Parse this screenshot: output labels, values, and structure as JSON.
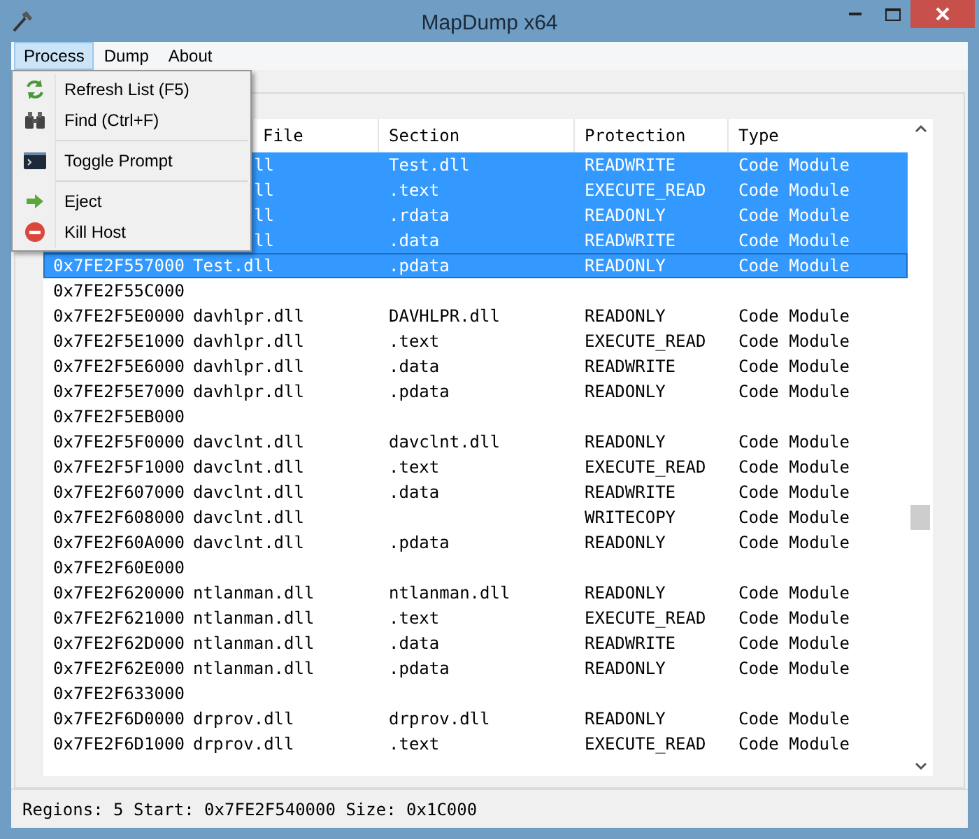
{
  "window": {
    "title": "MapDump x64"
  },
  "menubar": [
    {
      "label": "Process",
      "selected": true
    },
    {
      "label": "Dump",
      "selected": false
    },
    {
      "label": "About",
      "selected": false
    }
  ],
  "open_menu": [
    {
      "kind": "item",
      "label": "Refresh List (F5)"
    },
    {
      "kind": "item",
      "label": "Find (Ctrl+F)"
    },
    {
      "kind": "separator"
    },
    {
      "kind": "item",
      "label": "Toggle Prompt"
    },
    {
      "kind": "separator"
    },
    {
      "kind": "item",
      "label": "Eject"
    },
    {
      "kind": "item",
      "label": "Kill Host"
    }
  ],
  "table": {
    "columns": [
      "File",
      "Section",
      "Protection",
      "Type"
    ],
    "rows": [
      {
        "covered": true,
        "selected": true,
        "file": "ll",
        "section": "Test.dll",
        "protection": "READWRITE",
        "type": "Code Module"
      },
      {
        "covered": true,
        "selected": true,
        "file": "ll",
        "section": ".text",
        "protection": "EXECUTE_READ",
        "type": "Code Module"
      },
      {
        "covered": true,
        "selected": true,
        "file": "ll",
        "section": ".rdata",
        "protection": "READONLY",
        "type": "Code Module"
      },
      {
        "covered": true,
        "selected": true,
        "file": "ll",
        "section": ".data",
        "protection": "READWRITE",
        "type": "Code Module"
      },
      {
        "covered": false,
        "selected": true,
        "address": "0x7FE2F557000",
        "file": "Test.dll",
        "section": ".pdata",
        "protection": "READONLY",
        "type": "Code Module"
      },
      {
        "covered": false,
        "selected": false,
        "address": "0x7FE2F55C000"
      },
      {
        "covered": false,
        "selected": false,
        "address": "0x7FE2F5E0000",
        "file": "davhlpr.dll",
        "section": "DAVHLPR.dll",
        "protection": "READONLY",
        "type": "Code Module"
      },
      {
        "covered": false,
        "selected": false,
        "address": "0x7FE2F5E1000",
        "file": "davhlpr.dll",
        "section": ".text",
        "protection": "EXECUTE_READ",
        "type": "Code Module"
      },
      {
        "covered": false,
        "selected": false,
        "address": "0x7FE2F5E6000",
        "file": "davhlpr.dll",
        "section": ".data",
        "protection": "READWRITE",
        "type": "Code Module"
      },
      {
        "covered": false,
        "selected": false,
        "address": "0x7FE2F5E7000",
        "file": "davhlpr.dll",
        "section": ".pdata",
        "protection": "READONLY",
        "type": "Code Module"
      },
      {
        "covered": false,
        "selected": false,
        "address": "0x7FE2F5EB000"
      },
      {
        "covered": false,
        "selected": false,
        "address": "0x7FE2F5F0000",
        "file": "davclnt.dll",
        "section": "davclnt.dll",
        "protection": "READONLY",
        "type": "Code Module"
      },
      {
        "covered": false,
        "selected": false,
        "address": "0x7FE2F5F1000",
        "file": "davclnt.dll",
        "section": ".text",
        "protection": "EXECUTE_READ",
        "type": "Code Module"
      },
      {
        "covered": false,
        "selected": false,
        "address": "0x7FE2F607000",
        "file": "davclnt.dll",
        "section": ".data",
        "protection": "READWRITE",
        "type": "Code Module"
      },
      {
        "covered": false,
        "selected": false,
        "address": "0x7FE2F608000",
        "file": "davclnt.dll",
        "protection": "WRITECOPY",
        "type": "Code Module"
      },
      {
        "covered": false,
        "selected": false,
        "address": "0x7FE2F60A000",
        "file": "davclnt.dll",
        "section": ".pdata",
        "protection": "READONLY",
        "type": "Code Module"
      },
      {
        "covered": false,
        "selected": false,
        "address": "0x7FE2F60E000"
      },
      {
        "covered": false,
        "selected": false,
        "address": "0x7FE2F620000",
        "file": "ntlanman.dll",
        "section": "ntlanman.dll",
        "protection": "READONLY",
        "type": "Code Module"
      },
      {
        "covered": false,
        "selected": false,
        "address": "0x7FE2F621000",
        "file": "ntlanman.dll",
        "section": ".text",
        "protection": "EXECUTE_READ",
        "type": "Code Module"
      },
      {
        "covered": false,
        "selected": false,
        "address": "0x7FE2F62D000",
        "file": "ntlanman.dll",
        "section": ".data",
        "protection": "READWRITE",
        "type": "Code Module"
      },
      {
        "covered": false,
        "selected": false,
        "address": "0x7FE2F62E000",
        "file": "ntlanman.dll",
        "section": ".pdata",
        "protection": "READONLY",
        "type": "Code Module"
      },
      {
        "covered": false,
        "selected": false,
        "address": "0x7FE2F633000"
      },
      {
        "covered": false,
        "selected": false,
        "address": "0x7FE2F6D0000",
        "file": "drprov.dll",
        "section": "drprov.dll",
        "protection": "READONLY",
        "type": "Code Module"
      },
      {
        "covered": false,
        "selected": false,
        "address": "0x7FE2F6D1000",
        "file": "drprov.dll",
        "section": ".text",
        "protection": "EXECUTE_READ",
        "type": "Code Module"
      }
    ]
  },
  "status_bar": "Regions: 5 Start: 0x7FE2F540000 Size: 0x1C000"
}
